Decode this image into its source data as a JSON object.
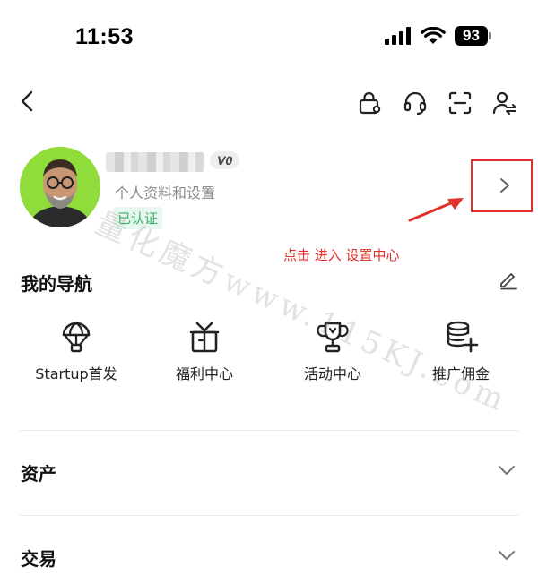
{
  "status_bar": {
    "time": "11:53",
    "battery": "93"
  },
  "profile": {
    "level": "V0",
    "subtitle": "个人资料和设置",
    "verified": "已认证"
  },
  "annotation": "点击 进入 设置中心",
  "watermark": "量化魔方www.115KJ.com",
  "navigation": {
    "title": "我的导航",
    "items": [
      {
        "label": "Startup首发",
        "icon": "parachute-icon"
      },
      {
        "label": "福利中心",
        "icon": "gift-icon"
      },
      {
        "label": "活动中心",
        "icon": "trophy-icon"
      },
      {
        "label": "推广佣金",
        "icon": "coin-stack-plus-icon"
      }
    ]
  },
  "sections": [
    {
      "label": "资产"
    },
    {
      "label": "交易"
    }
  ],
  "colors": {
    "highlight": "#e0312c",
    "verified": "#35b46a",
    "avatar_bg": "#8fdc3a"
  }
}
